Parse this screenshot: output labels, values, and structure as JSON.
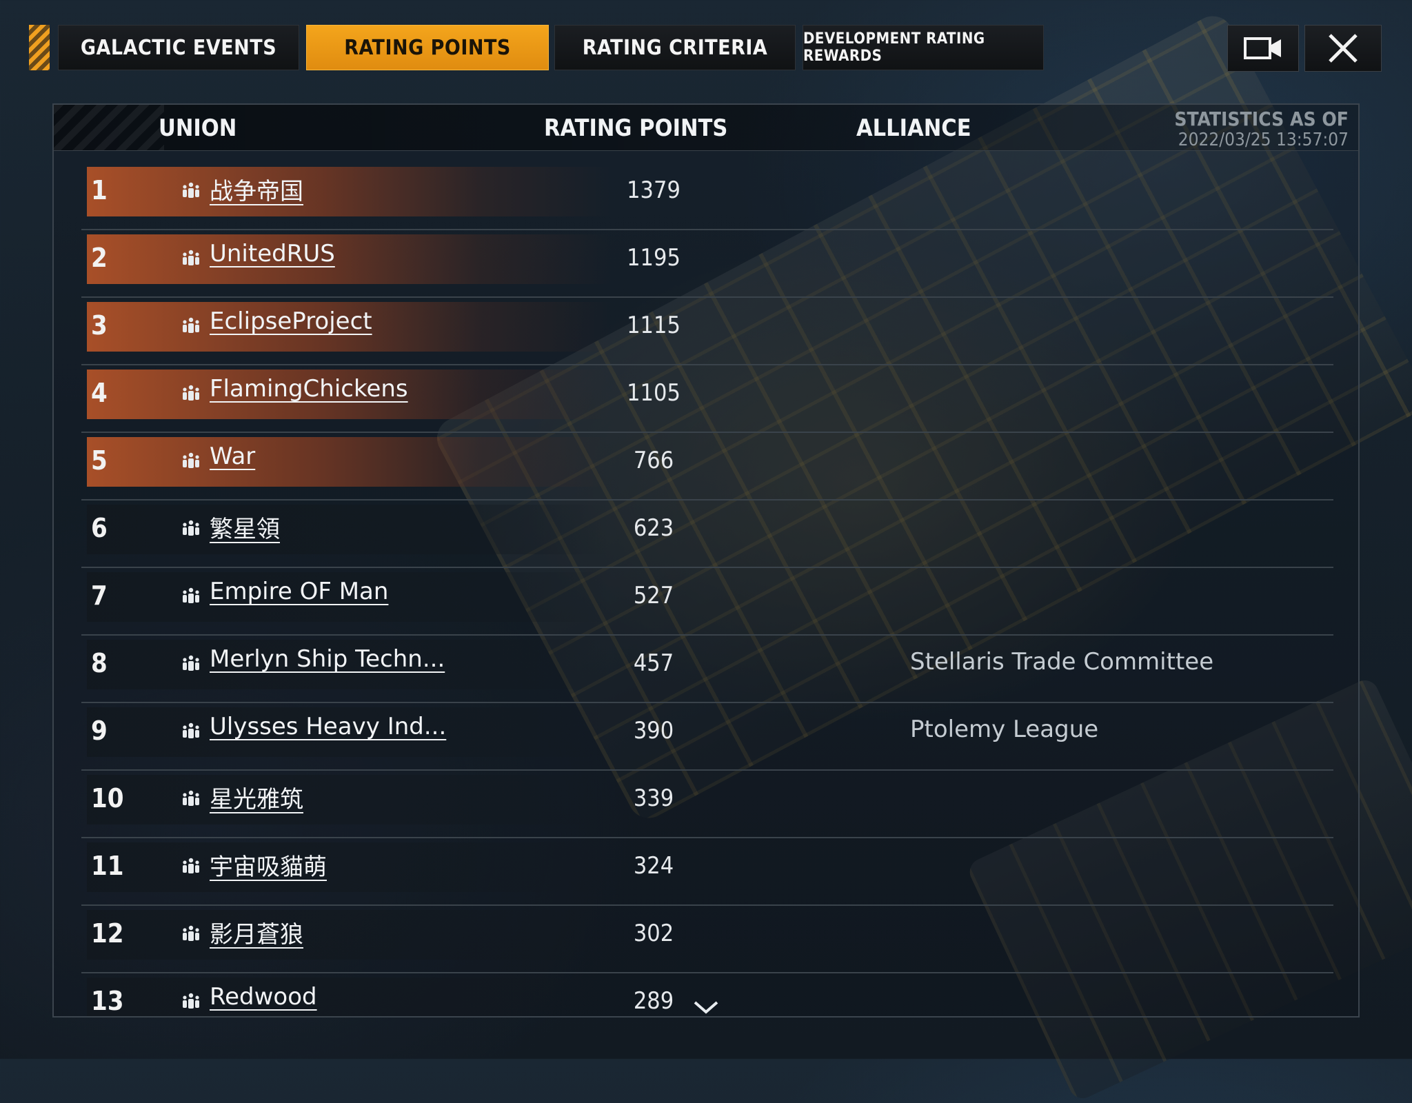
{
  "tabs": [
    {
      "label": "GALACTIC EVENTS",
      "active": false
    },
    {
      "label": "RATING POINTS",
      "active": true
    },
    {
      "label": "RATING CRITERIA",
      "active": false
    },
    {
      "label": "DEVELOPMENT RATING REWARDS",
      "active": false
    }
  ],
  "buttons": {
    "video": "video-camera-icon",
    "close": "close-icon"
  },
  "table": {
    "headers": {
      "union": "UNION",
      "points": "RATING POINTS",
      "alliance": "ALLIANCE"
    },
    "stats_label": "STATISTICS AS OF",
    "stats_time": "2022/03/25   13:57:07",
    "rows": [
      {
        "rank": "1",
        "name": "战争帝国",
        "points": "1379",
        "alliance": ""
      },
      {
        "rank": "2",
        "name": "UnitedRUS",
        "points": "1195",
        "alliance": ""
      },
      {
        "rank": "3",
        "name": "EclipseProject",
        "points": "1115",
        "alliance": ""
      },
      {
        "rank": "4",
        "name": "FlamingChickens",
        "points": "1105",
        "alliance": ""
      },
      {
        "rank": "5",
        "name": "War",
        "points": "766",
        "alliance": ""
      },
      {
        "rank": "6",
        "name": "繁星領",
        "points": "623",
        "alliance": ""
      },
      {
        "rank": "7",
        "name": "Empire OF Man",
        "points": "527",
        "alliance": ""
      },
      {
        "rank": "8",
        "name": "Merlyn Ship Techn...",
        "points": "457",
        "alliance": "Stellaris Trade Committee"
      },
      {
        "rank": "9",
        "name": "Ulysses Heavy Ind...",
        "points": "390",
        "alliance": "Ptolemy League"
      },
      {
        "rank": "10",
        "name": "星光雅筑",
        "points": "339",
        "alliance": ""
      },
      {
        "rank": "11",
        "name": "宇宙吸貓萌",
        "points": "324",
        "alliance": ""
      },
      {
        "rank": "12",
        "name": "影月蒼狼",
        "points": "302",
        "alliance": ""
      },
      {
        "rank": "13",
        "name": "Redwood",
        "points": "289",
        "alliance": ""
      }
    ]
  },
  "colors": {
    "accent": "#f4a51c",
    "top_row": "#b05228"
  }
}
